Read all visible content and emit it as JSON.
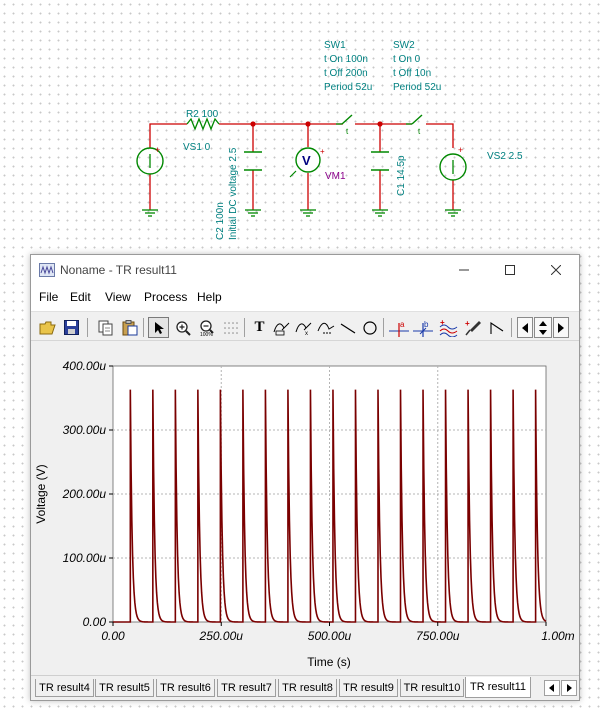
{
  "schematic": {
    "labels": {
      "r2": "R2 100",
      "vs1": "VS1 0",
      "c2_value": "C2 100n",
      "c2_ic": "Initial DC voltage 2.5",
      "vm1": "VM1",
      "vm_symbol": "V",
      "c1": "C1 14.5p",
      "vs2": "VS2 2.5",
      "sw1": [
        "SW1",
        "t On 100n",
        "t Off 200n",
        "Period 52u"
      ],
      "sw2": [
        "SW2",
        "t On 0",
        "t Off 10n",
        "Period 52u"
      ],
      "sw_marker": "t",
      "plus": "+"
    },
    "colors": {
      "wire": "#cc0000",
      "component": "#008800",
      "label": "#008080",
      "meter_label": "#8b008b"
    }
  },
  "window": {
    "title": "Noname - TR result11",
    "menu": [
      "File",
      "Edit",
      "View",
      "Process",
      "Help"
    ],
    "toolbar_text_tool": "T",
    "cursor_a": "a",
    "cursor_b": "b"
  },
  "tabs": [
    "TR result4",
    "TR result5",
    "TR result6",
    "TR result7",
    "TR result8",
    "TR result9",
    "TR result10",
    "TR result11"
  ],
  "active_tab": "TR result11",
  "chart_data": {
    "type": "line",
    "xlabel": "Time (s)",
    "ylabel": "Voltage (V)",
    "xlim": [
      0,
      0.001
    ],
    "ylim": [
      0,
      0.0004
    ],
    "x_ticks": [
      "0.00",
      "250.00u",
      "500.00u",
      "750.00u",
      "1.00m"
    ],
    "y_ticks": [
      "0.00",
      "100.00u",
      "200.00u",
      "300.00u",
      "400.00u"
    ],
    "grid": true,
    "line_color": "#7a0000",
    "series": [
      {
        "period": 5.2e-05,
        "first_pulse": 4e-05,
        "peak": 0.000363,
        "decay_time_constant": 4.2e-06,
        "pulse_count": 19
      }
    ]
  }
}
